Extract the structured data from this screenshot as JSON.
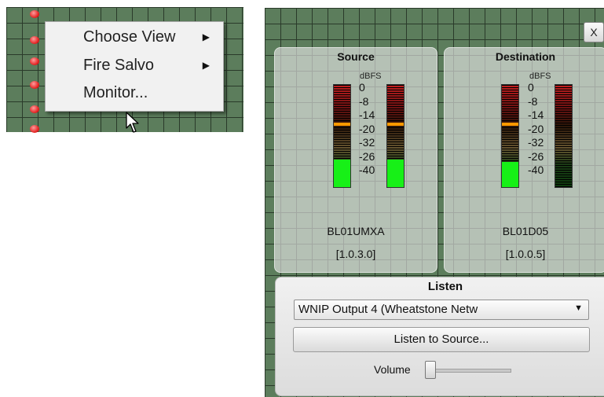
{
  "context_menu": {
    "items": [
      {
        "label": "Choose View",
        "has_submenu": true
      },
      {
        "label": "Fire Salvo",
        "has_submenu": true
      },
      {
        "label": "Monitor...",
        "has_submenu": false
      }
    ]
  },
  "monitor": {
    "close_label": "X",
    "source": {
      "title": "Source",
      "dbfs_label": "dBFS",
      "scale": [
        "0",
        "-8",
        "-14",
        "-20",
        "-32",
        "-26",
        "-40"
      ],
      "left_level": 0.27,
      "right_level": 0.27,
      "peak_level": 0.6,
      "device_name": "BL01UMXA",
      "address": "[1.0.3.0]"
    },
    "destination": {
      "title": "Destination",
      "dbfs_label": "dBFS",
      "scale": [
        "0",
        "-8",
        "-14",
        "-20",
        "-32",
        "-26",
        "-40"
      ],
      "left_level": 0.25,
      "right_level": 0,
      "peak_level": 0.6,
      "device_name": "BL01D05",
      "address": "[1.0.0.5]"
    },
    "listen": {
      "title": "Listen",
      "output_select": "WNIP Output  4 (Wheatstone Netw",
      "listen_button": "Listen to Source...",
      "volume_label": "Volume",
      "volume_level": 0
    }
  },
  "colors": {
    "grid_background": "#5c7d5c",
    "level_green": "#17f017",
    "peak_orange": "#ff9900",
    "dot_red": "#e21f1f"
  }
}
